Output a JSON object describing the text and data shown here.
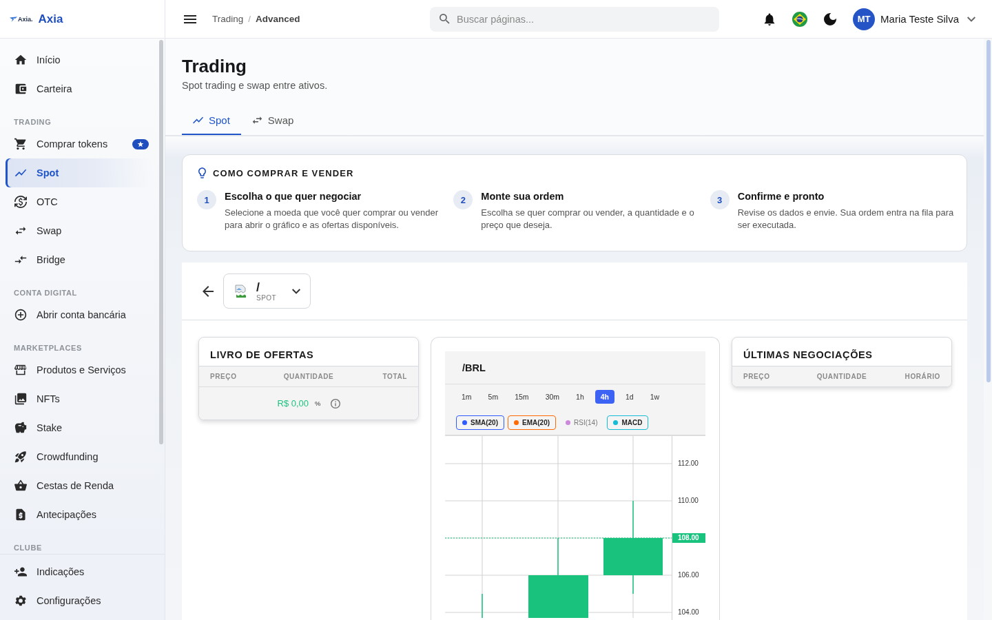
{
  "sidebar": {
    "logo": {
      "mark_text": "Axia.",
      "name": "Axia"
    },
    "sections": [
      {
        "items": [
          {
            "label": "Início",
            "selected": false,
            "featured": false
          },
          {
            "label": "Carteira",
            "selected": false,
            "featured": false
          }
        ]
      },
      {
        "title": "TRADING",
        "items": [
          {
            "label": "Comprar tokens",
            "selected": false,
            "featured": true
          },
          {
            "label": "Spot",
            "selected": true,
            "featured": false
          },
          {
            "label": "OTC",
            "selected": false,
            "featured": false
          },
          {
            "label": "Swap",
            "selected": false,
            "featured": false
          },
          {
            "label": "Bridge",
            "selected": false,
            "featured": false
          }
        ]
      },
      {
        "title": "CONTA DIGITAL",
        "items": [
          {
            "label": "Abrir conta bancária",
            "selected": false,
            "featured": false
          }
        ]
      },
      {
        "title": "MARKETPLACES",
        "items": [
          {
            "label": "Produtos e Serviços",
            "selected": false,
            "featured": false
          },
          {
            "label": "NFTs",
            "selected": false,
            "featured": false
          },
          {
            "label": "Stake",
            "selected": false,
            "featured": false
          },
          {
            "label": "Crowdfunding",
            "selected": false,
            "featured": false
          },
          {
            "label": "Cestas de Renda",
            "selected": false,
            "featured": false
          },
          {
            "label": "Antecipações",
            "selected": false,
            "featured": false
          }
        ]
      },
      {
        "title": "CLUBE"
      }
    ],
    "footer_items": [
      {
        "label": "Indicações",
        "selected": false
      },
      {
        "label": "Configurações",
        "selected": false
      }
    ]
  },
  "header": {
    "breadcrumb": {
      "separator": "/",
      "items": [
        {
          "label": "Trading",
          "current": false
        },
        {
          "label": "Advanced",
          "current": true
        }
      ]
    },
    "search": {
      "placeholder": "Buscar páginas..."
    },
    "user": {
      "initials": "MT",
      "name": "Maria Teste Silva"
    }
  },
  "page": {
    "title": "Trading",
    "subtitle": "Spot trading e swap entre ativos.",
    "tabs": [
      {
        "label": "Spot",
        "selected": true
      },
      {
        "label": "Swap",
        "selected": false
      }
    ]
  },
  "guide": {
    "title": "COMO COMPRAR E VENDER",
    "steps": [
      {
        "number": "1",
        "title": "Escolha o que quer negociar",
        "text": "Selecione a moeda que você quer comprar ou vender para abrir o gráfico e as ofertas disponíveis."
      },
      {
        "number": "2",
        "title": "Monte sua ordem",
        "text": "Escolha se quer comprar ou vender, a quantidade e o preço que deseja."
      },
      {
        "number": "3",
        "title": "Confirme e pronto",
        "text": "Revise os dados e envie. Sua ordem entra na fila para ser executada."
      }
    ]
  },
  "market": {
    "pair": {
      "symbol": "/",
      "type": "SPOT"
    },
    "order_book": {
      "title": "LIVRO DE OFERTAS",
      "columns": [
        "PREÇO",
        "QUANTIDADE",
        "TOTAL"
      ],
      "last_price": "R$ 0,00",
      "change": "%"
    },
    "chart": {
      "pair": "/BRL",
      "timeframes": [
        {
          "label": "1m",
          "selected": false
        },
        {
          "label": "5m",
          "selected": false
        },
        {
          "label": "15m",
          "selected": false
        },
        {
          "label": "30m",
          "selected": false
        },
        {
          "label": "1h",
          "selected": false
        },
        {
          "label": "4h",
          "selected": true
        },
        {
          "label": "1d",
          "selected": false
        },
        {
          "label": "1w",
          "selected": false
        }
      ],
      "indicators": [
        {
          "label": "SMA(20)",
          "selected": true,
          "color": "#2f5bff"
        },
        {
          "label": "EMA(20)",
          "selected": true,
          "color": "#ff6a00"
        },
        {
          "label": "RSI(14)",
          "selected": false,
          "color": "#cc88dd"
        },
        {
          "label": "MACD",
          "selected": true,
          "color": "#14bcd6"
        }
      ],
      "price_scale": {
        "ticks": [
          {
            "label": "112.00",
            "current": false
          },
          {
            "label": "110.00",
            "current": false
          },
          {
            "label": "108.00",
            "current": true
          },
          {
            "label": "106.00",
            "current": false
          },
          {
            "label": "104.00",
            "current": false
          }
        ]
      }
    },
    "recent_trades": {
      "title": "ÚLTIMAS NEGOCIAÇÕES",
      "columns": [
        "PREÇO",
        "QUANTIDADE",
        "HORÁRIO"
      ]
    }
  }
}
